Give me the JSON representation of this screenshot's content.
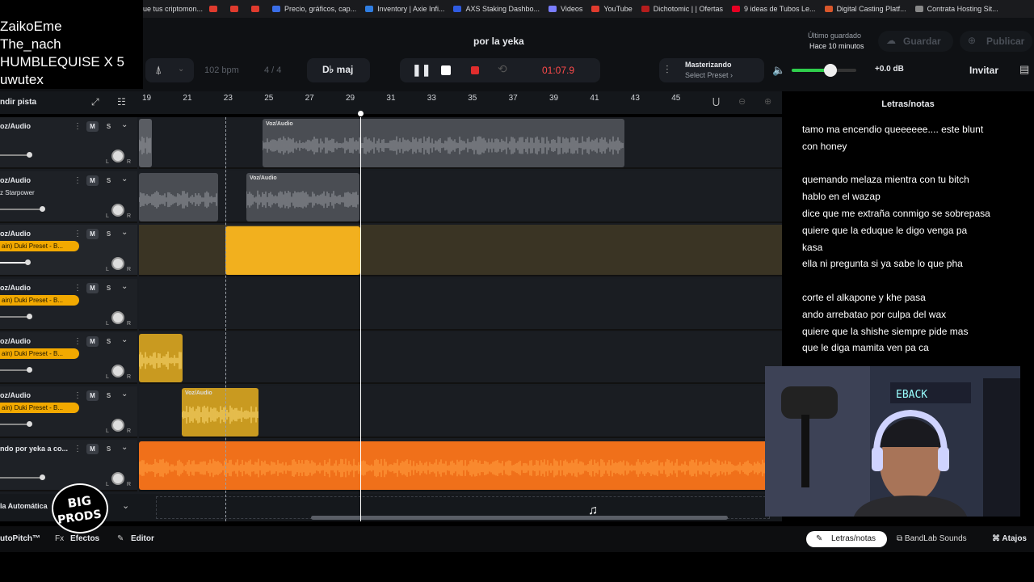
{
  "bookmarks": [
    {
      "label": "ue tus criptomon...",
      "color": "#e03b2e"
    },
    {
      "label": "",
      "color": "#e03b2e"
    },
    {
      "label": "",
      "color": "#e03b2e"
    },
    {
      "label": "Precio, gráficos, cap...",
      "color": "#3a6ee8"
    },
    {
      "label": "Inventory | Axie Infi...",
      "color": "#2f7de1"
    },
    {
      "label": "AXS Staking Dashbo...",
      "color": "#2f5be1"
    },
    {
      "label": "Videos",
      "color": "#7a7dff"
    },
    {
      "label": "YouTube",
      "color": "#e03b2e"
    },
    {
      "label": "Dichotomic | | Ofertas",
      "color": "#b51d1d"
    },
    {
      "label": "9 ideas de Tubos Le...",
      "color": "#e60023"
    },
    {
      "label": "Digital Casting Platf...",
      "color": "#d9572b"
    },
    {
      "label": "Contrata Hosting Sit...",
      "color": "#888888"
    }
  ],
  "chat_overlay": [
    "ZaikoEme",
    "The_nach",
    "HUMBLEQUISE X 5",
    "uwutex"
  ],
  "project": {
    "title": "por la yeka",
    "saved_label": "Último guardado",
    "saved_time": "Hace 10 minutos",
    "save_button": "Guardar",
    "publish_button": "Publicar",
    "invite_button": "Invitar"
  },
  "transport": {
    "bpm": "102",
    "bpm_unit": "bpm",
    "time_sig": "4 / 4",
    "key": "D♭ maj",
    "time": "01:07.9",
    "mastering_title": "Masterizando",
    "mastering_preset": "Select Preset ›",
    "volume_db": "+0.0 dB",
    "volume_level": 0.6
  },
  "ruler": {
    "add_track": "ndir pista",
    "bars": [
      "19",
      "21",
      "23",
      "25",
      "27",
      "29",
      "31",
      "33",
      "35",
      "37",
      "39",
      "41",
      "43",
      "45"
    ]
  },
  "tracks": [
    {
      "name": "oz/Audio",
      "preset": "",
      "sub": "",
      "clips": [
        {
          "label": ""
        },
        {
          "label": "Voz/Audio"
        }
      ]
    },
    {
      "name": "oz/Audio",
      "preset": "",
      "sub": "z Starpower",
      "clips": [
        {
          "label": ""
        },
        {
          "label": "Voz/Audio"
        }
      ]
    },
    {
      "name": "oz/Audio",
      "preset": "ain) Duki Preset - B...",
      "sub": "",
      "clips": [
        {
          "label": ""
        }
      ]
    },
    {
      "name": "oz/Audio",
      "preset": "ain) Duki Preset - B...",
      "sub": "",
      "clips": []
    },
    {
      "name": "oz/Audio",
      "preset": "ain) Duki Preset - B...",
      "sub": "",
      "clips": [
        {
          "label": ""
        }
      ]
    },
    {
      "name": "oz/Audio",
      "preset": "ain) Duki Preset - B...",
      "sub": "",
      "clips": [
        {
          "label": "Voz/Audio"
        }
      ]
    },
    {
      "name": "ndo por yeka a co...",
      "preset": "",
      "sub": "",
      "clips": [
        {
          "label": ""
        }
      ]
    }
  ],
  "automation_label": "la Automática",
  "lyrics": {
    "title": "Letras/notas",
    "lines": [
      " tamo ma encendio queeeeee.... este blunt",
      "con honey",
      "",
      "quemando melaza mientra con tu bitch",
      "hablo en el wazap",
      "dice que me extraña conmigo se sobrepasa",
      " quiere que la eduque le digo venga pa",
      "kasa",
      "ella ni pregunta si ya sabe lo que pha",
      "",
      " corte el alkapone y khe pasa",
      "ando arrebatao por culpa del wax",
      "quiere que la shishe siempre pide mas",
      "que  le diga mamita ven  pa ca"
    ]
  },
  "bottom": {
    "autopitch": "utoPitch™",
    "effects": "Efectos",
    "editor": "Editor",
    "lyrics_tab": "Letras/notas",
    "sounds_tab": "BandLab Sounds",
    "shortcuts": "Atajos"
  },
  "logo_text": "BIG PRODS",
  "colors": {
    "accent_yellow": "#f2b01e",
    "accent_orange": "#f0701a",
    "record_red": "#e02d2d",
    "time_red": "#ff4b4b"
  }
}
